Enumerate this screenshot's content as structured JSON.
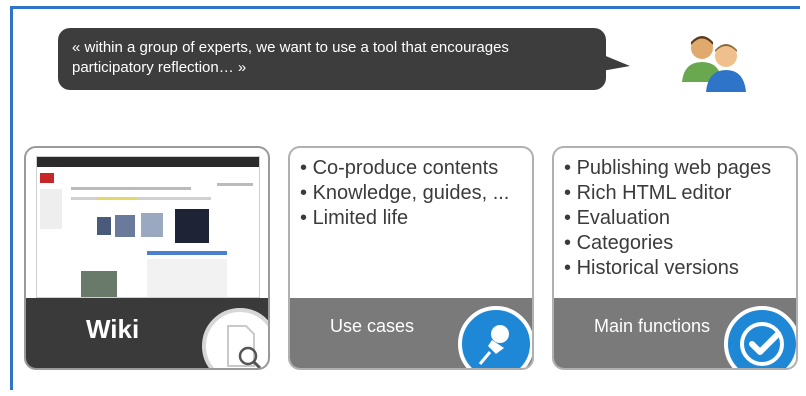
{
  "quote": "« within a group of experts, we want to use a tool that encourages participatory reflection… »",
  "icons": {
    "people": "users-icon",
    "wiki": "document-search-icon",
    "use_cases": "pushpin-icon",
    "main_functions": "checkmark-icon"
  },
  "colors": {
    "accent": "#2e74c8",
    "badge_blue": "#1f88d6",
    "dark": "#3a3a3a",
    "grey": "#7a7a7a"
  },
  "cards": [
    {
      "title": "Wiki"
    },
    {
      "title": "Use cases",
      "items": [
        "Co-produce contents",
        "Knowledge, guides, ...",
        "Limited life"
      ]
    },
    {
      "title": "Main functions",
      "items": [
        "Publishing web pages",
        "Rich HTML editor",
        "Evaluation",
        "Categories",
        "Historical versions"
      ]
    }
  ]
}
